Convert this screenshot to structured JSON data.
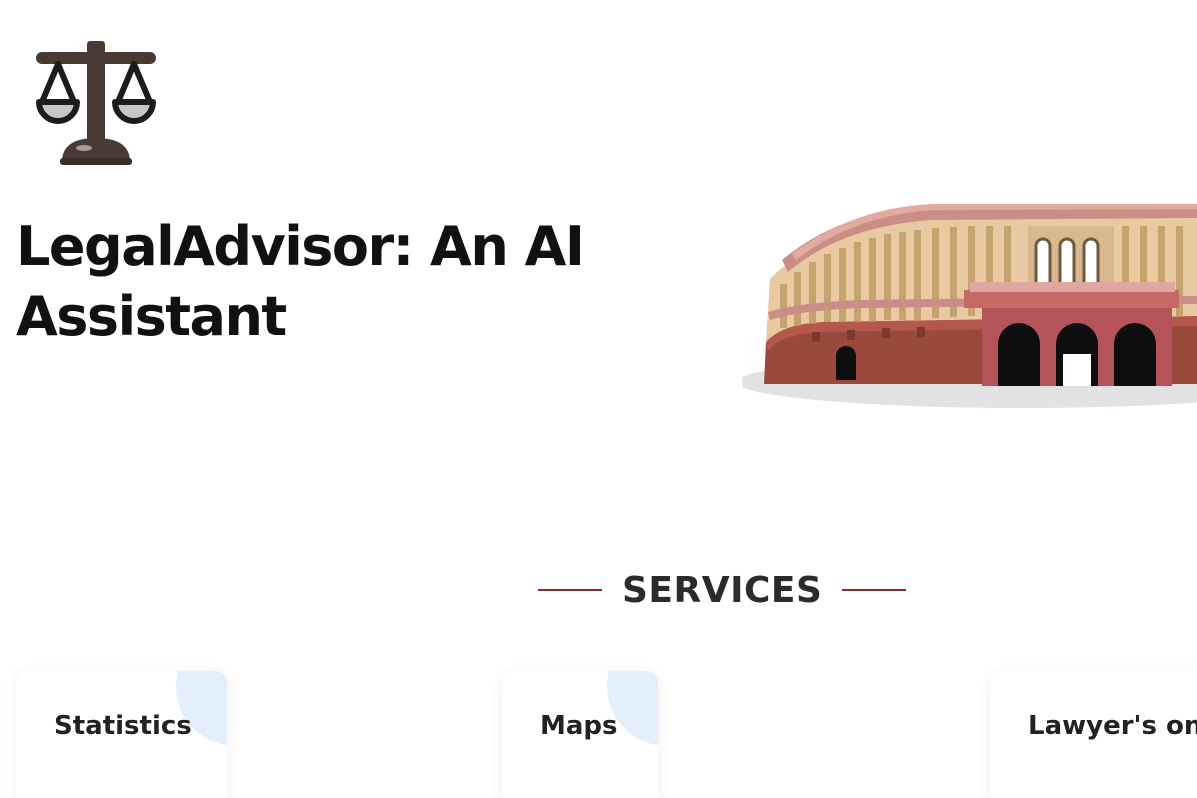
{
  "brand": {
    "logo_icon": "scales-of-justice-icon"
  },
  "hero": {
    "title": "LegalAdvisor: An AI Assistant",
    "illustration": "parliament-building"
  },
  "services": {
    "heading": "SERVICES",
    "cards": [
      {
        "label": "Statistics"
      },
      {
        "label": "Maps"
      },
      {
        "label": "Lawyer's on"
      }
    ]
  },
  "colors": {
    "accent_line": "#8b2b2b",
    "card_decoration": "#e3effb",
    "heading_text": "#111111"
  }
}
